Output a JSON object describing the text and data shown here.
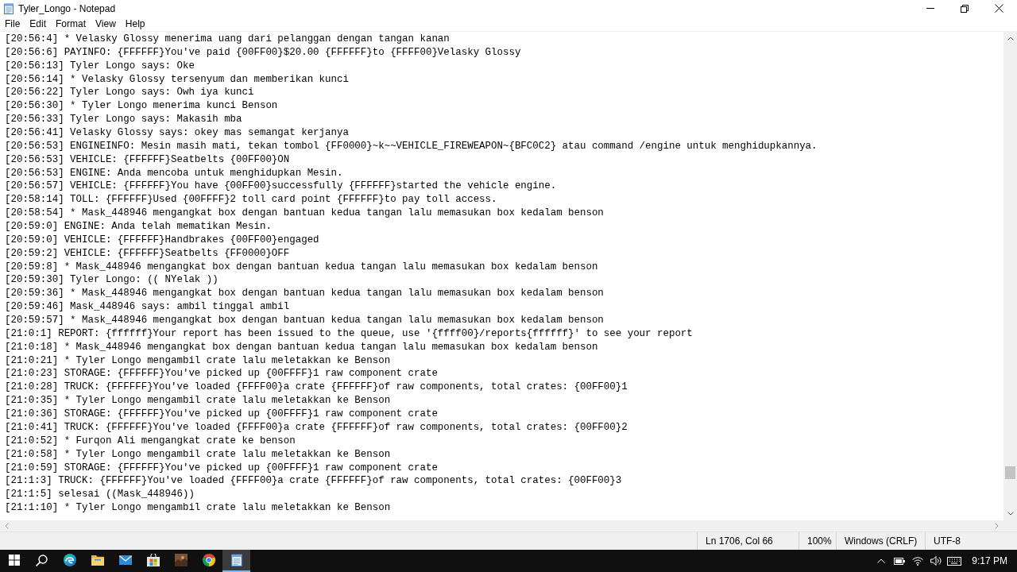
{
  "window": {
    "title": "Tyler_Longo - Notepad"
  },
  "menu": [
    "File",
    "Edit",
    "Format",
    "View",
    "Help"
  ],
  "editor": {
    "lines": [
      "[20:56:4] * Velasky Glossy menerima uang dari pelanggan dengan tangan kanan",
      "[20:56:6] PAYINFO: {FFFFFF}You've paid {00FF00}$20.00 {FFFFFF}to {FFFF00}Velasky Glossy",
      "[20:56:13] Tyler Longo says: Oke",
      "[20:56:14] * Velasky Glossy tersenyum dan memberikan kunci",
      "[20:56:22] Tyler Longo says: Owh iya kunci",
      "[20:56:30] * Tyler Longo menerima kunci Benson",
      "[20:56:33] Tyler Longo says: Makasih mba",
      "[20:56:41] Velasky Glossy says: okey mas semangat kerjanya",
      "[20:56:53] ENGINEINFO: Mesin masih mati, tekan tombol {FF0000}~k~~VEHICLE_FIREWEAPON~{BFC0C2} atau command /engine untuk menghidupkannya.",
      "[20:56:53] VEHICLE: {FFFFFF}Seatbelts {00FF00}ON",
      "[20:56:53] ENGINE: Anda mencoba untuk menghidupkan Mesin.",
      "[20:56:57] VEHICLE: {FFFFFF}You have {00FF00}successfully {FFFFFF}started the vehicle engine.",
      "[20:58:14] TOLL: {FFFFFF}Used {00FFFF}2 toll card point {FFFFFF}to pay toll access.",
      "[20:58:54] * Mask_448946 mengangkat box dengan bantuan kedua tangan lalu memasukan box kedalam benson",
      "[20:59:0] ENGINE: Anda telah mematikan Mesin.",
      "[20:59:0] VEHICLE: {FFFFFF}Handbrakes {00FF00}engaged",
      "[20:59:2] VEHICLE: {FFFFFF}Seatbelts {FF0000}OFF",
      "[20:59:8] * Mask_448946 mengangkat box dengan bantuan kedua tangan lalu memasukan box kedalam benson",
      "[20:59:30] Tyler Longo: (( NYelak ))",
      "[20:59:36] * Mask_448946 mengangkat box dengan bantuan kedua tangan lalu memasukan box kedalam benson",
      "[20:59:46] Mask_448946 says: ambil tinggal ambil",
      "[20:59:57] * Mask_448946 mengangkat box dengan bantuan kedua tangan lalu memasukan box kedalam benson",
      "[21:0:1] REPORT: {ffffff}Your report has been issued to the queue, use '{ffff00}/reports{ffffff}' to see your report",
      "[21:0:18] * Mask_448946 mengangkat box dengan bantuan kedua tangan lalu memasukan box kedalam benson",
      "[21:0:21] * Tyler Longo mengambil crate lalu meletakkan ke Benson",
      "[21:0:23] STORAGE: {FFFFFF}You've picked up {00FFFF}1 raw component crate",
      "[21:0:28] TRUCK: {FFFFFF}You've loaded {FFFF00}a crate {FFFFFF}of raw components, total crates: {00FF00}1",
      "[21:0:35] * Tyler Longo mengambil crate lalu meletakkan ke Benson",
      "[21:0:36] STORAGE: {FFFFFF}You've picked up {00FFFF}1 raw component crate",
      "[21:0:41] TRUCK: {FFFFFF}You've loaded {FFFF00}a crate {FFFFFF}of raw components, total crates: {00FF00}2",
      "[21:0:52] * Furqon Ali mengangkat crate ke benson",
      "[21:0:58] * Tyler Longo mengambil crate lalu meletakkan ke Benson",
      "[21:0:59] STORAGE: {FFFFFF}You've picked up {00FFFF}1 raw component crate",
      "[21:1:3] TRUCK: {FFFFFF}You've loaded {FFFF00}a crate {FFFFFF}of raw components, total crates: {00FF00}3",
      "[21:1:5] selesai ((Mask_448946))",
      "[21:1:10] * Tyler Longo mengambil crate lalu meletakkan ke Benson"
    ]
  },
  "status_bar": {
    "position": "Ln 1706, Col 66",
    "zoom": "100%",
    "line_ending": "Windows (CRLF)",
    "encoding": "UTF-8"
  },
  "taskbar": {
    "apps": [
      {
        "kind": "start",
        "selected": false
      },
      {
        "kind": "search",
        "selected": false
      },
      {
        "kind": "swirl",
        "selected": false
      },
      {
        "kind": "folder",
        "selected": false
      },
      {
        "kind": "mail",
        "selected": false
      },
      {
        "kind": "bag",
        "selected": false
      },
      {
        "kind": "tile",
        "selected": false
      },
      {
        "kind": "tricolor",
        "selected": false
      },
      {
        "kind": "notepad",
        "selected": true
      }
    ],
    "clock": "9:17 PM"
  }
}
